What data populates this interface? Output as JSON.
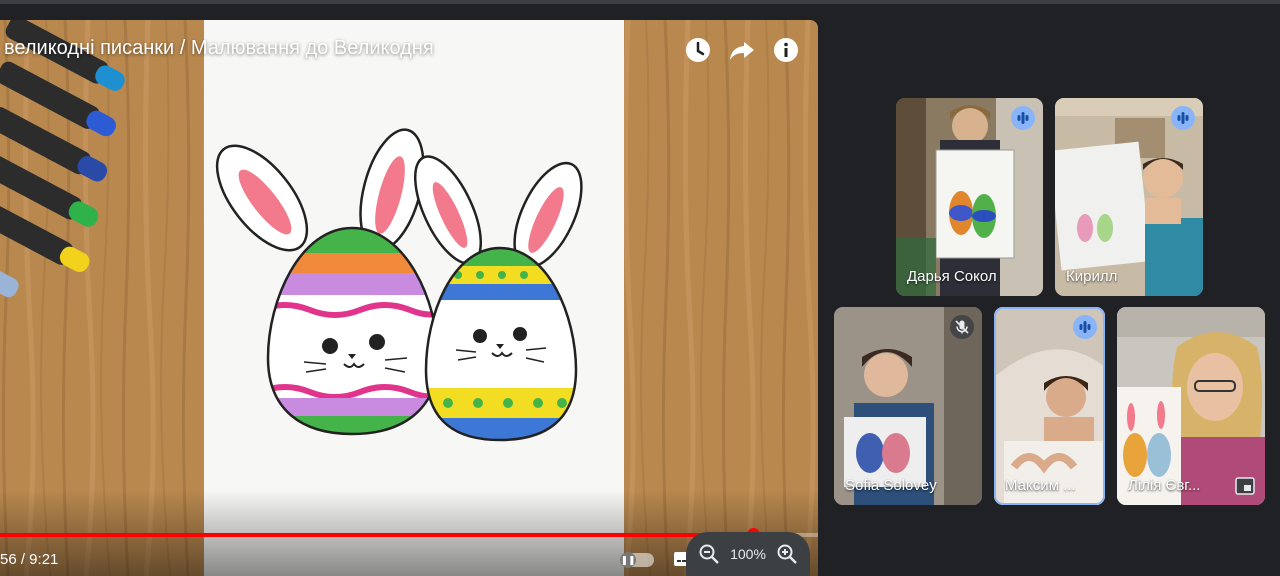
{
  "video": {
    "title": "великодні писанки / Малювання до Великодня",
    "time": "56 / 9:21",
    "progress": 0.92,
    "icons": [
      "watch-later-icon",
      "share-icon",
      "info-icon"
    ]
  },
  "zoom": {
    "value": "100%"
  },
  "participants": [
    {
      "name": "Дарья Сокол",
      "status": "speaking"
    },
    {
      "name": "Кирилл",
      "status": "speaking"
    },
    {
      "name": "Sofia Solovey",
      "status": "muted"
    },
    {
      "name": "Максим ...",
      "status": "speaking"
    },
    {
      "name": "Лілія Євг...",
      "status": "none"
    }
  ],
  "colors": {
    "accent": "#8ab4f8",
    "progress": "#ff0000",
    "background": "#202124"
  }
}
